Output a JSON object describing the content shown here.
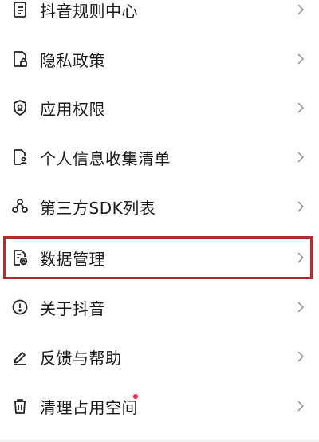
{
  "menu": {
    "items": [
      {
        "label": "抖音规则中心",
        "icon": "rules-document-icon"
      },
      {
        "label": "隐私政策",
        "icon": "privacy-lock-icon"
      },
      {
        "label": "应用权限",
        "icon": "permission-shield-icon"
      },
      {
        "label": "个人信息收集清单",
        "icon": "personal-info-document-icon"
      },
      {
        "label": "第三方SDK列表",
        "icon": "sdk-nodes-icon"
      },
      {
        "label": "数据管理",
        "icon": "data-management-icon"
      },
      {
        "label": "关于抖音",
        "icon": "info-circle-icon"
      },
      {
        "label": "反馈与帮助",
        "icon": "feedback-pen-icon"
      },
      {
        "label": "清理占用空间",
        "icon": "trash-icon"
      }
    ],
    "highlighted_item": "数据管理",
    "notification_dot_item": "清理占用空间"
  },
  "colors": {
    "text": "#1a1a1a",
    "icon": "#222222",
    "chevron": "#9a9a9a",
    "highlight_border": "#b42b2e",
    "notification_dot": "#f0244f"
  }
}
